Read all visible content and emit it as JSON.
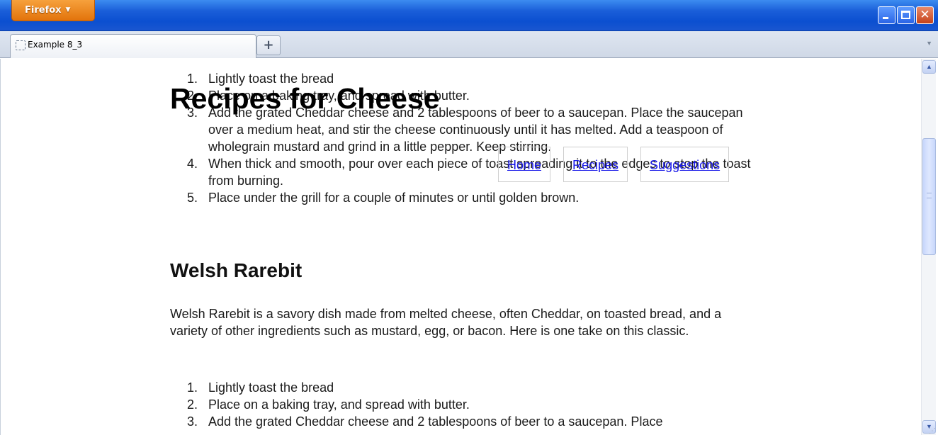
{
  "window": {
    "app_button_label": "Firefox",
    "app_button_arrow": "▼",
    "controls": {
      "minimize": "minimize-icon",
      "maximize": "maximize-icon",
      "close_glyph": "✕"
    }
  },
  "tabs": [
    {
      "label": "Example 8_3",
      "active": true
    }
  ],
  "new_tab_glyph": "+",
  "tab_list_glyph": "▼",
  "page": {
    "overlay_title": "Recipes for Cheese",
    "nav": [
      "Home",
      "Recipes",
      "Suggestions"
    ],
    "list1": [
      {
        "num": "1.",
        "text": "Lightly toast the bread"
      },
      {
        "num": "2.",
        "text": "Place on a baking tray, and spread with butter."
      },
      {
        "num": "3.",
        "text": "Add the grated Cheddar cheese and 2 tablespoons of beer to a saucepan. Place the saucepan over a medium heat, and stir the cheese continuously until it has melted. Add a teaspoon of wholegrain mustard and grind in a little pepper. Keep stirring."
      },
      {
        "num": "4.",
        "text": "When thick and smooth, pour over each piece of toast spreading it to the edges to stop the toast from burning."
      },
      {
        "num": "5.",
        "text": "Place under the grill for a couple of minutes or until golden brown."
      }
    ],
    "section_heading": "Welsh Rarebit",
    "intro": "Welsh Rarebit is a savory dish made from melted cheese, often Cheddar, on toasted bread, and a variety of other ingredients such as mustard, egg, or bacon. Here is one take on this classic.",
    "list2": [
      {
        "num": "1.",
        "text": "Lightly toast the bread"
      },
      {
        "num": "2.",
        "text": "Place on a baking tray, and spread with butter."
      },
      {
        "num": "3.",
        "text": "Add the grated Cheddar cheese and 2 tablespoons of beer to a saucepan. Place"
      }
    ]
  },
  "scrollbar": {
    "up_glyph": "▲",
    "down_glyph": "▼",
    "position_fraction": 0.25
  },
  "colors": {
    "titlebar": "#1b5fd9",
    "firefox_button": "#e8790f",
    "link": "#1a1ae8"
  }
}
